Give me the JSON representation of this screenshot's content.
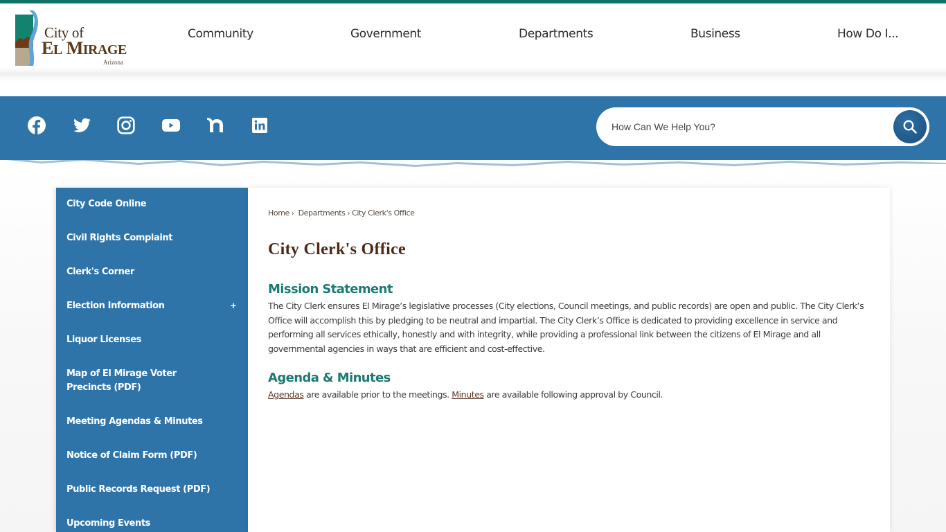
{
  "brand": {
    "accent_topbar": "#117368",
    "band_blue": "#2e74a8",
    "heading_teal": "#1c7a72",
    "title_brown": "#4a2a16",
    "logo": {
      "line1": "City of",
      "line2": "El Mirage",
      "line3": "Arizona"
    }
  },
  "nav": {
    "items": [
      {
        "label": "Community"
      },
      {
        "label": "Government"
      },
      {
        "label": "Departments"
      },
      {
        "label": "Business"
      },
      {
        "label": "How Do I..."
      }
    ]
  },
  "social": [
    {
      "name": "facebook-icon"
    },
    {
      "name": "twitter-icon"
    },
    {
      "name": "instagram-icon"
    },
    {
      "name": "youtube-icon"
    },
    {
      "name": "nextdoor-icon"
    },
    {
      "name": "linkedin-icon"
    }
  ],
  "search": {
    "placeholder": "How Can We Help You?",
    "value": "",
    "button_icon": "search-icon"
  },
  "sidebar": {
    "items": [
      {
        "label": "City Code Online"
      },
      {
        "label": "Civil Rights Complaint"
      },
      {
        "label": "Clerk's Corner"
      },
      {
        "label": "Election Information",
        "expandable": true,
        "expand_symbol": "+"
      },
      {
        "label": "Liquor Licenses"
      },
      {
        "label": "Map of El Mirage Voter Precincts (PDF)"
      },
      {
        "label": "Meeting Agendas & Minutes"
      },
      {
        "label": "Notice of Claim Form (PDF)"
      },
      {
        "label": "Public Records Request (PDF)"
      },
      {
        "label": "Upcoming Events"
      }
    ]
  },
  "breadcrumb": {
    "items": [
      "Home",
      "Departments",
      "City Clerk's Office"
    ],
    "separator": "›"
  },
  "main": {
    "title": "City Clerk's Office",
    "sections": [
      {
        "heading": "Mission Statement",
        "text": "The City Clerk ensures El Mirage’s legislative processes (City elections, Council meetings, and public records) are open and public. The City Clerk’s Office will accomplish this by pledging to be neutral and impartial. The City Clerk’s Office is dedicated to providing excellence in service and performing all services ethically, honestly and with integrity, while providing a professional link between the citizens of El Mirage and all governmental agencies in ways that are efficient and cost-effective."
      },
      {
        "heading": "Agenda & Minutes",
        "link1": "Agendas",
        "text1": " are available prior to the meetings. ",
        "link2": "Minutes",
        "text2": " are available following approval by Council."
      }
    ]
  }
}
